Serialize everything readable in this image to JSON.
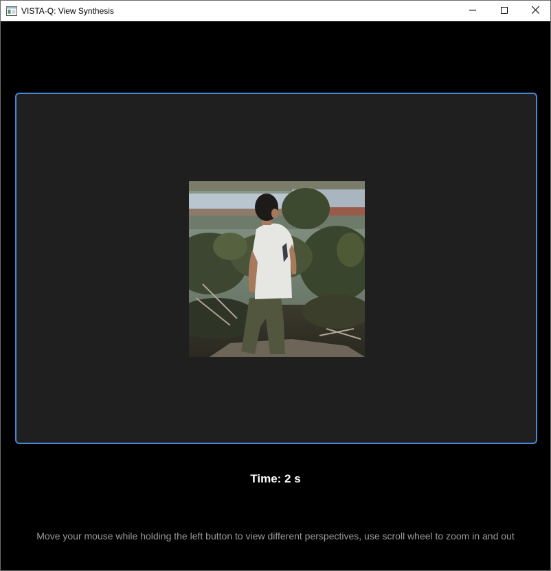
{
  "window": {
    "title": "VISTA-Q: View Synthesis",
    "icon": "app-window-icon",
    "controls": {
      "minimize_icon": "minimize-icon",
      "maximize_icon": "maximize-icon",
      "close_icon": "close-icon"
    }
  },
  "viewport": {
    "accent_color": "#4a86d8",
    "background_color": "#1f1f1f",
    "scene": "photo of a man in a white t-shirt walking among shrubs on a hillside, buildings in the background"
  },
  "status": {
    "time_label": "Time: 2 s"
  },
  "help": {
    "instructions": "Move your mouse while holding the left button to view different perspectives, use scroll wheel to zoom in and out"
  }
}
